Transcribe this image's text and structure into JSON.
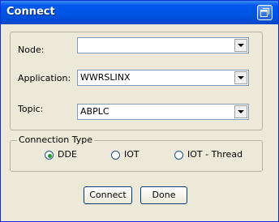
{
  "window": {
    "title": "Connect"
  },
  "form": {
    "node": {
      "label": "Node:",
      "value": ""
    },
    "application": {
      "label": "Application:",
      "value": "WWRSLINX"
    },
    "topic": {
      "label": "Topic:",
      "value": "ABPLC"
    }
  },
  "connection_type": {
    "legend": "Connection Type",
    "options": [
      {
        "label": "DDE",
        "selected": true
      },
      {
        "label": "IOT",
        "selected": false
      },
      {
        "label": "IOT - Thread",
        "selected": false
      }
    ]
  },
  "buttons": {
    "connect": "Connect",
    "done": "Done"
  },
  "colors": {
    "title_bar": "#0054e3",
    "dialog_bg": "#ece9d8",
    "radio_selected": "#21a121"
  }
}
